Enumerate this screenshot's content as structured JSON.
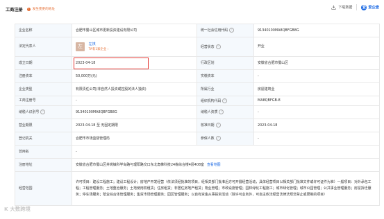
{
  "header": {
    "title": "工商注册",
    "warning": "发生变更的地址",
    "download": "下载数据",
    "brand": "爱企查",
    "brand_icon": "爱"
  },
  "rows": [
    {
      "k1": "企业名称",
      "v1": "合肥市蜀山区城市更新投资建设有限公司",
      "k2": "统一社会信用代码",
      "v2": "91340100MA8QBFGB8G"
    },
    {
      "k1": "法定代表人",
      "avatar": "左",
      "rep_name": "左祺",
      "rep_sub": "TA有1家企业 ›",
      "k2": "经营状态",
      "v2": "开业"
    },
    {
      "k1": "成立日期",
      "v1": "2023-04-18",
      "k2": "行政区划",
      "v2": "安徽省合肥市蜀山区"
    },
    {
      "k1": "注册资本",
      "v1": "",
      "k2": "实缴资本",
      "v2": "-"
    },
    {
      "k1": "企业类型",
      "v1": "有限责任公司(非自然人投资或控股的法人独资)",
      "k2": "所属行业",
      "v2": "房屋建筑业"
    },
    {
      "k1": "工商注册号",
      "v1": "-",
      "k2": "组织机构代码",
      "v2": "MA8QBFGB-8"
    },
    {
      "k1": "纳税人识别号",
      "v1": "91340100MA8QBFGB8G",
      "k2": "纳税人资质",
      "v2": "-"
    },
    {
      "k1": "营业期限",
      "v1": "2023-04-18 至 无固定期限",
      "k2": "核准日期",
      "v2": "2023-04-18"
    },
    {
      "k1": "登记机关",
      "v1": "合肥市市场监督管理局",
      "k2": "参保人数",
      "v2": "-"
    },
    {
      "k1": "曾用名",
      "v1": "-"
    },
    {
      "k1": "注册地址",
      "v1": "安徽省合肥市蜀山区井岗镇科学岛路与理阳路交口东北角帷科技24栋综合楼4层408室",
      "link": "查看地图"
    },
    {
      "k1": "经营范围",
      "v1": "许可项目：建设工程施工；建设工程设计；房地产开发经营（依法须经批准的项目，经相关部门批准后方可开展经营活动，具体经营项目以相关部门批准文件或许可证件为准）一般项目：对外承包工程；工程管理服务；土地整治服务；土地使用权租赁；住房租赁；非居住房地产租赁；物业管理；市政设施管理；园林绿化工程施工；城市绿化管理；城市公园管理；公共事业管理服务；房屋拆迁服务；停车场服务；殡业综合体管理服务；集贸市场管理服务；园区管理服务；以自有资金从事投资活动（除许可业务外，可自主依法经营法律法规非禁止或限制的项目）"
    }
  ],
  "registered_capital": "50,000万(元)",
  "watermark": "大数跨境",
  "watermark_icon": "K"
}
